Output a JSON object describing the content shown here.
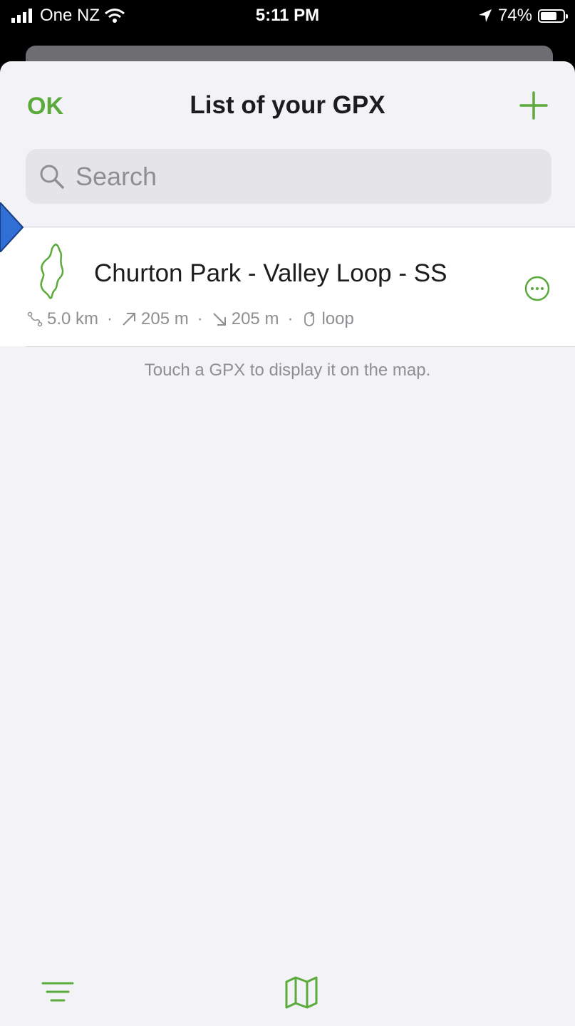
{
  "status_bar": {
    "carrier": "One NZ",
    "time": "5:11 PM",
    "battery": "74%",
    "battery_level": 0.74
  },
  "nav": {
    "ok_label": "OK",
    "title": "List of your GPX",
    "add_icon": "plus-icon"
  },
  "search": {
    "placeholder": "Search",
    "value": ""
  },
  "gpx_list": [
    {
      "title": "Churton Park - Valley Loop - SS",
      "distance": "5.0 km",
      "ascent": "205 m",
      "descent": "205 m",
      "type": "loop",
      "color": "#5aaa3c"
    }
  ],
  "hint": "Touch a GPX to display it on the map.",
  "colors": {
    "accent": "#5aaa3c",
    "selection_arrow": "#2f6fd6"
  }
}
